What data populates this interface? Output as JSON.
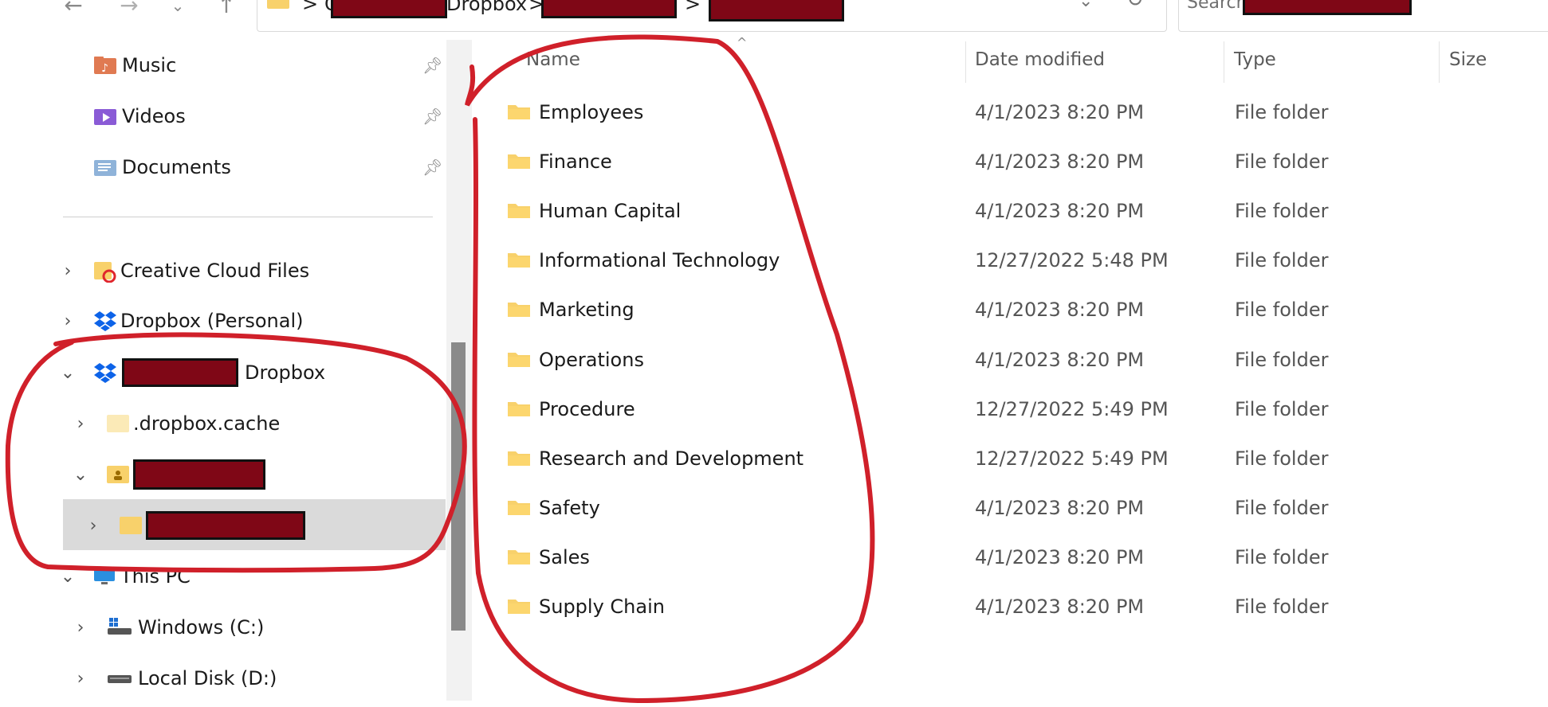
{
  "toolbar": {
    "back_icon": "arrow-left-icon",
    "forward_icon": "arrow-right-icon",
    "recent_icon": "chevron-down-icon",
    "up_icon": "arrow-up-icon",
    "refresh_icon": "refresh-icon"
  },
  "address": {
    "crumb_leading": "C",
    "crumb_dropbox": "Dropbox",
    "sep": ">"
  },
  "search": {
    "placeholder": "Search"
  },
  "sidebar": {
    "quick_access": [
      {
        "label": "Music",
        "icon": "music-folder-icon"
      },
      {
        "label": "Videos",
        "icon": "videos-folder-icon"
      },
      {
        "label": "Documents",
        "icon": "documents-folder-icon"
      }
    ],
    "tree": {
      "creative_cloud": "Creative Cloud Files",
      "dropbox_personal": "Dropbox (Personal)",
      "dropbox_team_suffix": "Dropbox",
      "dropbox_cache": ".dropbox.cache",
      "this_pc": "This PC",
      "windows_c": "Windows (C:)",
      "local_disk_d": "Local Disk (D:)"
    }
  },
  "columns": {
    "name": "Name",
    "date": "Date modified",
    "type": "Type",
    "size": "Size"
  },
  "files": [
    {
      "name": "Employees",
      "date": "4/1/2023 8:20 PM",
      "type": "File folder"
    },
    {
      "name": "Finance",
      "date": "4/1/2023 8:20 PM",
      "type": "File folder"
    },
    {
      "name": "Human Capital",
      "date": "4/1/2023 8:20 PM",
      "type": "File folder"
    },
    {
      "name": "Informational Technology",
      "date": "12/27/2022 5:48 PM",
      "type": "File folder"
    },
    {
      "name": "Marketing",
      "date": "4/1/2023 8:20 PM",
      "type": "File folder"
    },
    {
      "name": "Operations",
      "date": "4/1/2023 8:20 PM",
      "type": "File folder"
    },
    {
      "name": "Procedure",
      "date": "12/27/2022 5:49 PM",
      "type": "File folder"
    },
    {
      "name": "Research and Development",
      "date": "12/27/2022 5:49 PM",
      "type": "File folder"
    },
    {
      "name": "Safety",
      "date": "4/1/2023 8:20 PM",
      "type": "File folder"
    },
    {
      "name": "Sales",
      "date": "4/1/2023 8:20 PM",
      "type": "File folder"
    },
    {
      "name": "Supply Chain",
      "date": "4/1/2023 8:20 PM",
      "type": "File folder"
    }
  ],
  "colors": {
    "annotation_red": "#d0202a",
    "redaction": "#7f0716",
    "folder_yellow": "#f8d16b",
    "selected_bg": "#dadada"
  }
}
